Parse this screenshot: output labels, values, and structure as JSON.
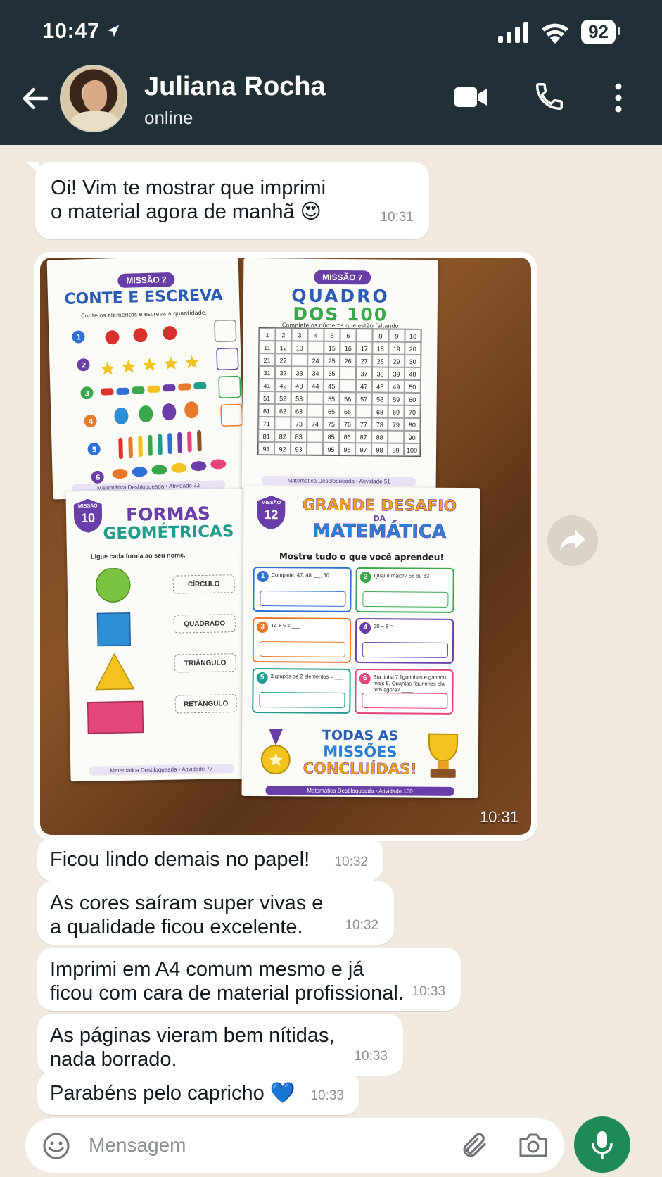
{
  "status_bar": {
    "time": "10:47",
    "battery": "92"
  },
  "header": {
    "contact_name": "Juliana Rocha",
    "contact_status": "online"
  },
  "messages": [
    {
      "text": "Oi! Vim te mostrar que imprimi\no material agora de manhã 😍",
      "time": "10:31"
    },
    {
      "type": "image",
      "time": "10:31"
    },
    {
      "text": "Ficou lindo demais no papel!",
      "time": "10:32"
    },
    {
      "text": "As cores saíram super vivas e\na qualidade ficou excelente.",
      "time": "10:32"
    },
    {
      "text": "Imprimi em A4 comum mesmo e já\nficou com cara de material profissional.",
      "time": "10:33"
    },
    {
      "text": "As páginas vieram bem nítidas,\nnada borrado.",
      "time": "10:33"
    },
    {
      "text": "Parabéns pelo capricho 💙",
      "time": "10:33"
    }
  ],
  "photo": {
    "sheet1": {
      "mission": "MISSÃO 2",
      "title": "CONTE E ESCREVA",
      "subtitle": "Conte os elementos e escreva a quantidade.",
      "footer": "Matemática Desbloqueada • Atividade 32"
    },
    "sheet2": {
      "mission": "MISSÃO 7",
      "title1": "QUADRO",
      "title2": "DOS 100",
      "subtitle": "Complete os números que estão faltando",
      "footer": "Matemática Desbloqueada • Atividade 51"
    },
    "sheet3": {
      "mission_small": "MISSÃO",
      "mission_number": "10",
      "title1": "FORMAS",
      "title2": "GEOMÉTRICAS",
      "instruction": "Ligue cada forma ao seu nome.",
      "shapes": [
        "CÍRCULO",
        "QUADRADO",
        "TRIÂNGULO",
        "RETÂNGULO"
      ],
      "footer": "Matemática Desbloqueada • Atividade 77"
    },
    "sheet4": {
      "mission_small": "MISSÃO",
      "mission_number": "12",
      "title1": "GRANDE DESAFIO",
      "title_da": "DA",
      "title2": "MATEMÁTICA",
      "subtitle": "Mostre tudo o que você aprendeu!",
      "tasks": [
        {
          "n": "1",
          "text": "Complete: 47, 48, __, 50",
          "color": "#2f6fd6"
        },
        {
          "n": "2",
          "text": "Qual é maior? 58 ou 63",
          "color": "#3aa84a"
        },
        {
          "n": "3",
          "text": "14 + 5 = ___",
          "color": "#e8782a"
        },
        {
          "n": "4",
          "text": "20 − 8 = ___",
          "color": "#6a3ea8"
        },
        {
          "n": "5",
          "text": "3 grupos de 2 elementos = ___",
          "color": "#1f9c8c"
        },
        {
          "n": "6",
          "text": "Bia tinha 7 figurinhas e ganhou mais 5. Quantas figurinhas ela tem agora? ____",
          "color": "#e2467a"
        }
      ],
      "banner1": "TODAS AS",
      "banner2": "MISSÕES",
      "banner3": "CONCLUÍDAS!",
      "footer": "Matemática Desbloqueada • Atividade 100"
    }
  },
  "input": {
    "placeholder": "Mensagem"
  },
  "colors": {
    "header_bg": "#212f37",
    "chat_bg": "#efe9df",
    "mic_bg": "#1f8a55"
  }
}
